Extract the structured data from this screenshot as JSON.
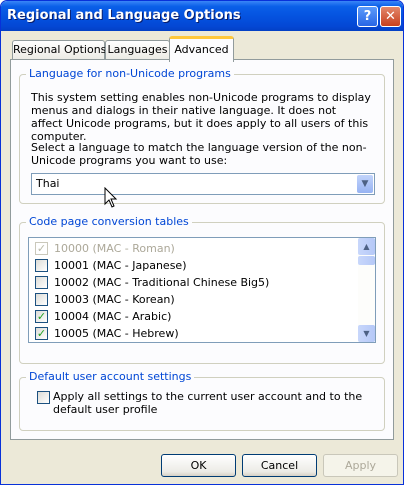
{
  "window": {
    "title": "Regional and Language Options",
    "help_glyph": "?",
    "close_glyph": "✕"
  },
  "tabs": [
    {
      "label": "Regional Options"
    },
    {
      "label": "Languages"
    },
    {
      "label": "Advanced",
      "selected": true
    }
  ],
  "non_unicode": {
    "group_title": "Language for non-Unicode programs",
    "description": "This system setting enables non-Unicode programs to display menus and dialogs in their native language. It does not affect Unicode programs, but it does apply to all users of this computer.",
    "select_prompt": "Select a language to match the language version of the non-Unicode programs you want to use:",
    "selected_language": "Thai"
  },
  "code_pages": {
    "group_title": "Code page conversion tables",
    "items": [
      {
        "label": "10000 (MAC - Roman)",
        "checked": true,
        "disabled": true
      },
      {
        "label": "10001 (MAC - Japanese)",
        "checked": false,
        "disabled": false
      },
      {
        "label": "10002 (MAC - Traditional Chinese Big5)",
        "checked": false,
        "disabled": false
      },
      {
        "label": "10003 (MAC - Korean)",
        "checked": false,
        "disabled": false
      },
      {
        "label": "10004 (MAC - Arabic)",
        "checked": true,
        "disabled": false
      },
      {
        "label": "10005 (MAC - Hebrew)",
        "checked": true,
        "disabled": false
      }
    ]
  },
  "default_account": {
    "group_title": "Default user account settings",
    "apply_all_label": "Apply all settings to the current user account and to the default user profile",
    "apply_all_checked": false
  },
  "buttons": {
    "ok": "OK",
    "cancel": "Cancel",
    "apply": "Apply"
  },
  "icons": {
    "combo_arrow": "chevron-down-icon",
    "scroll_up": "scroll-up-arrow-icon",
    "scroll_down": "scroll-down-arrow-icon",
    "cursor": "mouse-pointer-icon"
  },
  "colors": {
    "titlebar": "#0553e0",
    "group_title": "#0046d5",
    "tab_highlight": "#ffc83c",
    "check": "#21a121"
  }
}
